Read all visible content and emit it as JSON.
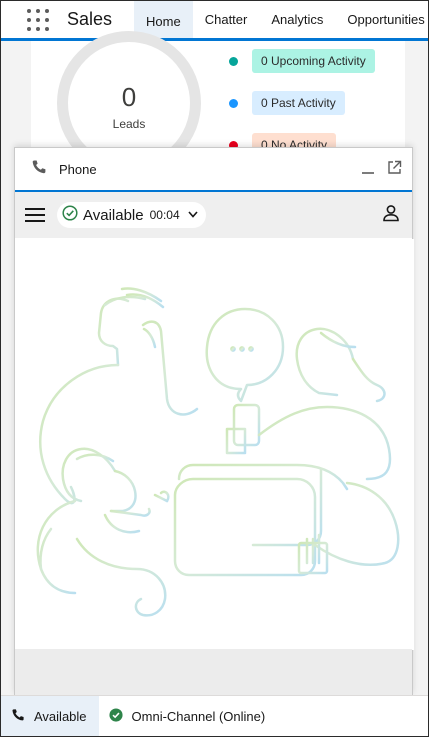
{
  "app": {
    "name": "Sales",
    "tabs": [
      {
        "label": "Home",
        "active": true
      },
      {
        "label": "Chatter",
        "active": false
      },
      {
        "label": "Analytics",
        "active": false
      },
      {
        "label": "Opportunities",
        "active": false
      }
    ]
  },
  "dashboard": {
    "gauge_value": "0",
    "gauge_label": "Leads",
    "legend": [
      {
        "label": "0 Upcoming Activity",
        "dot_color": "#06a59a",
        "pill_color": "#acf3e4"
      },
      {
        "label": "0 Past Activity",
        "dot_color": "#1b96ff",
        "pill_color": "#d8edff"
      },
      {
        "label": "0 No Activity",
        "dot_color": "#ea001e",
        "pill_color": "#fedfd0"
      }
    ]
  },
  "phone_panel": {
    "title": "Phone",
    "icons": {
      "phone": "phone-icon",
      "minimize": "minimize-icon",
      "popout": "popout-icon"
    },
    "status": {
      "label": "Available",
      "timer": "00:04",
      "color": "#2e844a"
    }
  },
  "utility_bar": {
    "items": [
      {
        "label": "Available",
        "icon": "phone-icon",
        "active": true
      },
      {
        "label": "Omni-Channel (Online)",
        "icon": "check-circle-icon",
        "active": false
      }
    ]
  }
}
